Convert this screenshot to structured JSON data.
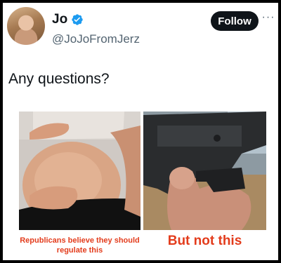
{
  "user": {
    "display_name": "Jo",
    "handle": "@JoJoFromJerz",
    "avatar_icon": "profile-photo",
    "verified_icon": "verified-badge-icon",
    "verified_color": "#1d9bf0"
  },
  "actions": {
    "follow_label": "Follow",
    "more_icon": "more-options-icon",
    "more_glyph": "···"
  },
  "tweet": {
    "text": "Any questions?"
  },
  "media": {
    "left_caption": "Republicans believe they should regulate this",
    "right_caption": "But not this",
    "caption_color": "#e33c1c"
  }
}
